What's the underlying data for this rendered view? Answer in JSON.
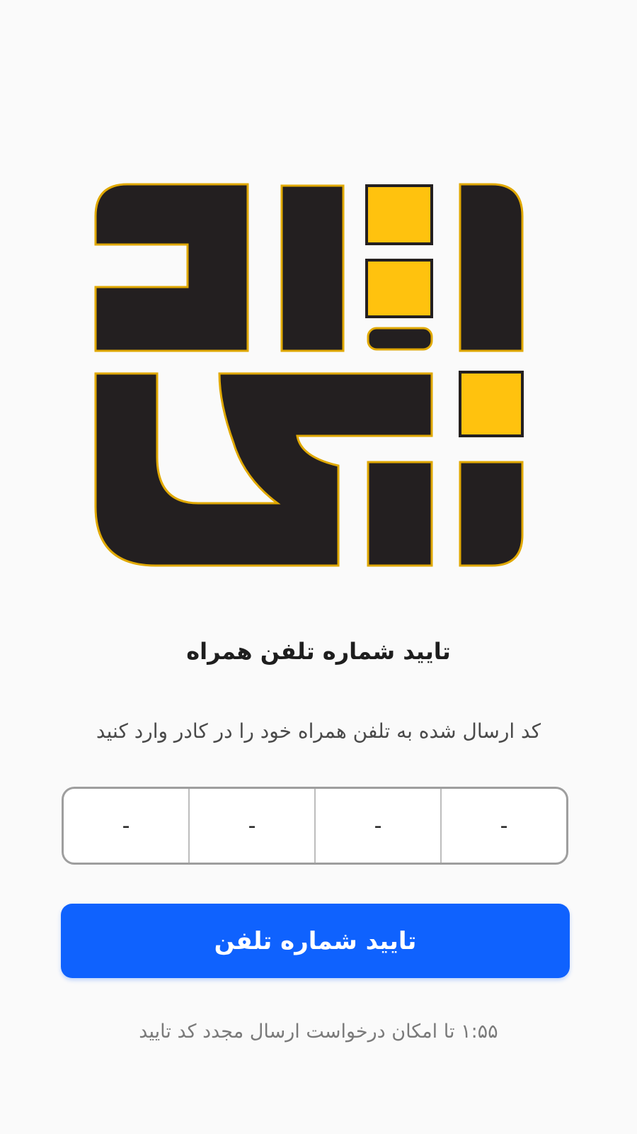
{
  "brand": {
    "logo": "logo",
    "colors": {
      "dark": "#231f20",
      "yellow": "#ffc20e",
      "outline": "#e0a800"
    }
  },
  "verification": {
    "title": "تایید شماره تلفن همراه",
    "instruction": "کد ارسال شده به تلفن همراه خود را در کادر وارد کنید",
    "code_cells": [
      "-",
      "-",
      "-",
      "-"
    ],
    "submit_label": "تایید شماره تلفن",
    "resend_text": "۱:۵۵ تا امکان درخواست ارسال مجدد کد تایید"
  },
  "colors": {
    "background": "#fafafa",
    "primary": "#0f62fe",
    "input_border": "#9e9e9e"
  }
}
